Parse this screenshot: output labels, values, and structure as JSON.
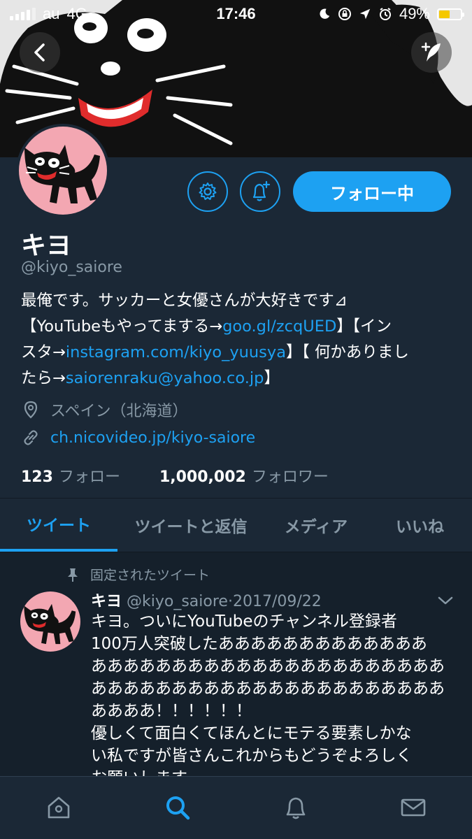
{
  "status_bar": {
    "carrier": "au",
    "network": "4G",
    "time": "17:46",
    "battery_percent": "49%",
    "battery_level": 0.49
  },
  "profile": {
    "display_name": "キヨ",
    "handle": "@kiyo_saiore",
    "follow_button_label": "フォロー中",
    "bio": {
      "line1": "最俺です。サッカーと女優さんが大好きです⊿",
      "line2_pre": "【YouTubeもやってまする→",
      "line2_link": "goo.gl/zcqUED",
      "line2_post": "】【イン",
      "line3_pre": "スタ→",
      "line3_link": "instagram.com/kiyo_yuusya",
      "line3_post": "】【 何かありまし",
      "line4_pre": "たら→",
      "line4_link": "saiorenraku@yahoo.co.jp",
      "line4_post": "】"
    },
    "location": "スペイン（北海道）",
    "website": "ch.nicovideo.jp/kiyo-saiore",
    "following_count": "123",
    "following_label": "フォロー",
    "followers_count": "1,000,002",
    "followers_label": "フォロワー"
  },
  "tabs": [
    {
      "label": "ツイート",
      "active": true
    },
    {
      "label": "ツイートと返信",
      "active": false
    },
    {
      "label": "メディア",
      "active": false
    },
    {
      "label": "いいね",
      "active": false
    }
  ],
  "tweet": {
    "pinned_label": "固定されたツイート",
    "author_name": "キヨ",
    "author_handle": "@kiyo_saiore",
    "separator": "·",
    "date": "2017/09/22",
    "lines": [
      "キヨ。ついにYouTubeのチャンネル登録者",
      "100万人突破したあああああああああああああ",
      "ああああああああああああああああああああああ",
      "ああああああああああああああああああああああ",
      "ああああ！！！！！！",
      "優しくて面白くてほんとにモテる要素しかな",
      "い私ですが皆さんこれからもどうぞよろしく",
      "お願いします。"
    ]
  },
  "colors": {
    "background": "#1b2836",
    "feed_background": "#15202b",
    "accent": "#1da1f2",
    "secondary_text": "#8899a6",
    "avatar_pink": "#f3a7b2"
  },
  "icons": {
    "back": "chevron-left-icon",
    "compose": "feather-plus-icon",
    "settings": "gear-icon",
    "notify": "bell-plus-icon",
    "location": "map-pin-icon",
    "link": "link-icon",
    "pin": "pushpin-icon",
    "chevron": "chevron-down-icon",
    "nav": [
      "home-icon",
      "search-icon",
      "bell-icon",
      "mail-icon"
    ]
  }
}
